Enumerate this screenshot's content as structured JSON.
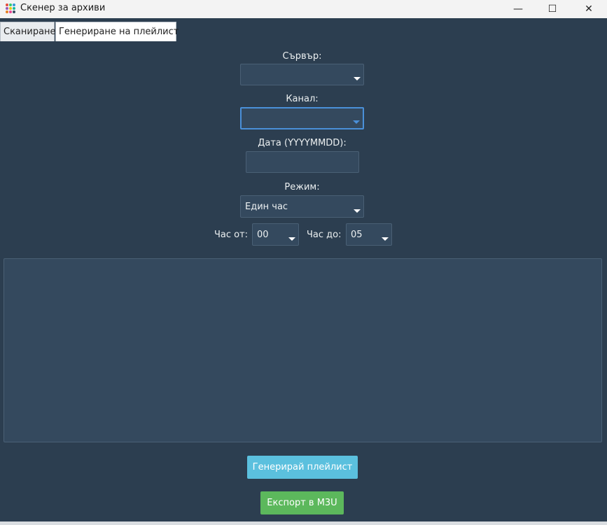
{
  "window": {
    "title": "Скенер за архиви",
    "minimize_glyph": "—",
    "maximize_glyph": "☐",
    "close_glyph": "✕"
  },
  "tabs": [
    {
      "label": "Сканиране",
      "active": false
    },
    {
      "label": "Генериране на плейлист",
      "active": true
    }
  ],
  "form": {
    "server_label": "Сървър:",
    "server_value": "",
    "channel_label": "Канал:",
    "channel_value": "",
    "date_label": "Дата (YYYYMMDD):",
    "date_value": "",
    "mode_label": "Режим:",
    "mode_value": "Един час",
    "hour_from_label": "Час от:",
    "hour_from_value": "00",
    "hour_to_label": "Час до:",
    "hour_to_value": "05"
  },
  "output": {
    "text": ""
  },
  "buttons": {
    "generate_label": "Генерирай плейлист",
    "export_label": "Експорт в M3U"
  },
  "colors": {
    "background": "#2c3e50",
    "field": "#34495e",
    "focus": "#4a90d9",
    "generate": "#5bc0de",
    "export": "#5cb85c"
  },
  "icons": {
    "app": "app-dots-icon",
    "dropdown": "chevron-down-icon"
  }
}
